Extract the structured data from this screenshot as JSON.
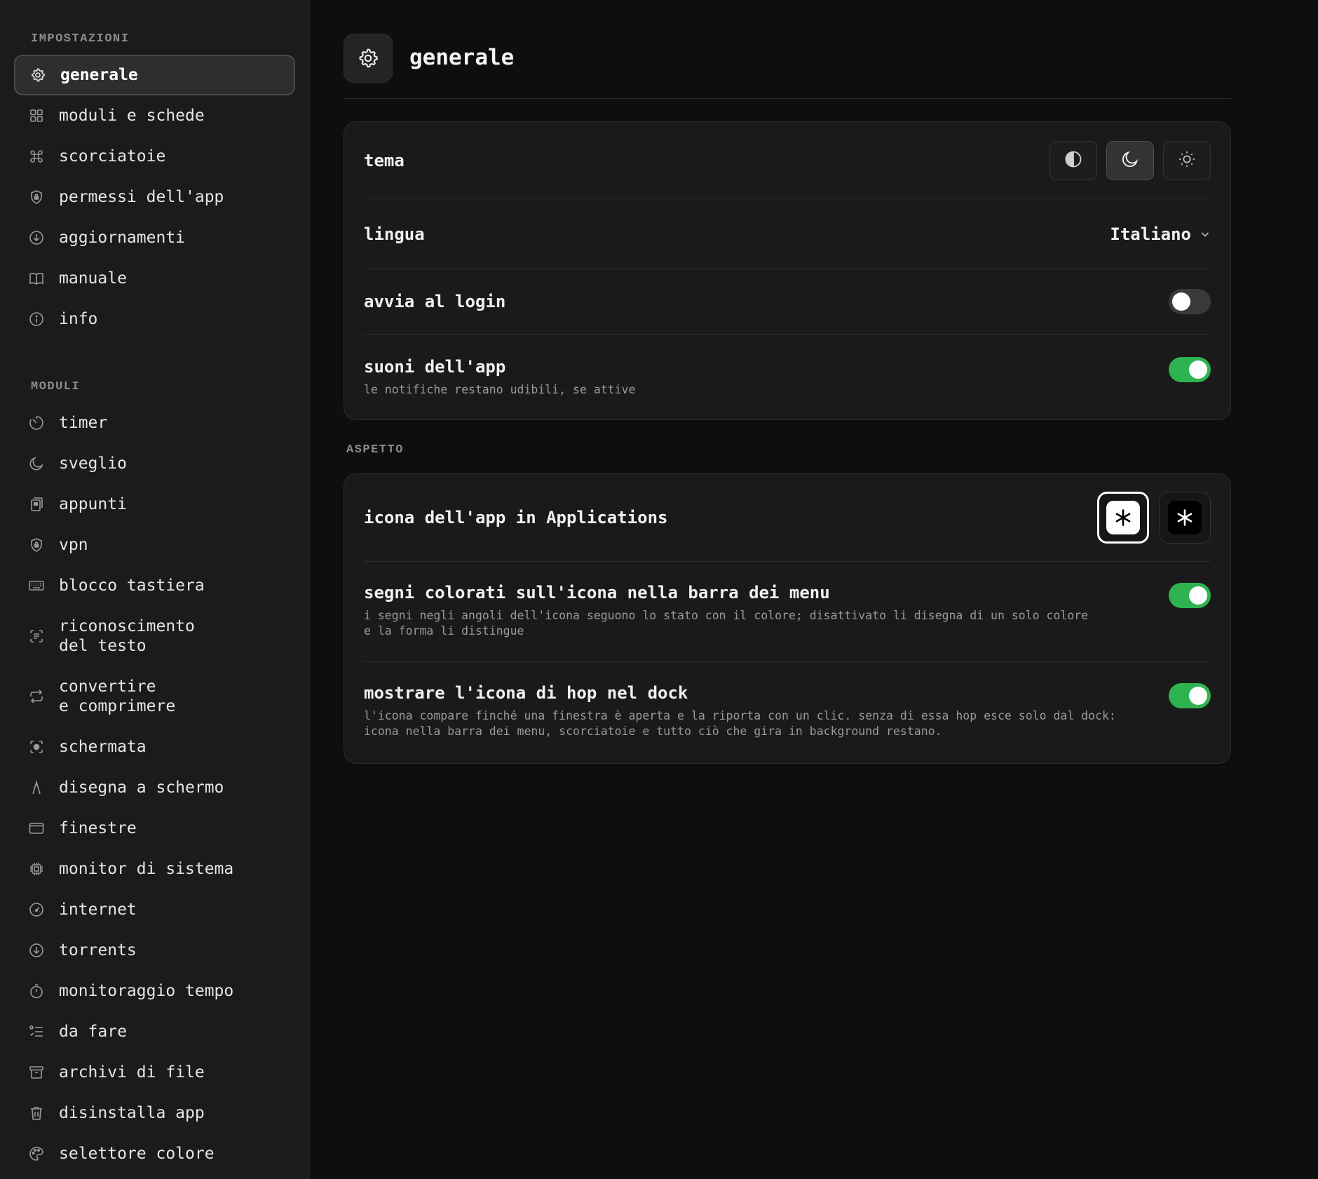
{
  "sidebar": {
    "section_settings": "IMPOSTAZIONI",
    "settings_items": [
      {
        "label": "generale",
        "icon": "gear-icon"
      },
      {
        "label": "moduli e schede",
        "icon": "grid-icon"
      },
      {
        "label": "scorciatoie",
        "icon": "command-icon"
      },
      {
        "label": "permessi dell'app",
        "icon": "shield-lock-icon"
      },
      {
        "label": "aggiornamenti",
        "icon": "download-circle-icon"
      },
      {
        "label": "manuale",
        "icon": "book-icon"
      },
      {
        "label": "info",
        "icon": "info-icon"
      }
    ],
    "section_modules": "MODULI",
    "module_items": [
      {
        "label": "timer",
        "icon": "timer-icon"
      },
      {
        "label": "sveglio",
        "icon": "moon-icon"
      },
      {
        "label": "appunti",
        "icon": "clipboard-icon"
      },
      {
        "label": "vpn",
        "icon": "shield-lock-icon"
      },
      {
        "label": "blocco tastiera",
        "icon": "keyboard-icon"
      },
      {
        "label": "riconoscimento\ndel testo",
        "icon": "text-scan-icon"
      },
      {
        "label": "convertire\ne comprimere",
        "icon": "convert-icon"
      },
      {
        "label": "schermata",
        "icon": "screenshot-icon"
      },
      {
        "label": "disegna a schermo",
        "icon": "pen-icon"
      },
      {
        "label": "finestre",
        "icon": "window-icon"
      },
      {
        "label": "monitor di sistema",
        "icon": "cpu-icon"
      },
      {
        "label": "internet",
        "icon": "speedometer-icon"
      },
      {
        "label": "torrents",
        "icon": "download-circle-icon"
      },
      {
        "label": "monitoraggio tempo",
        "icon": "stopwatch-icon"
      },
      {
        "label": "da fare",
        "icon": "checklist-icon"
      },
      {
        "label": "archivi di file",
        "icon": "archive-icon"
      },
      {
        "label": "disinstalla app",
        "icon": "trash-icon"
      },
      {
        "label": "selettore colore",
        "icon": "palette-icon"
      }
    ]
  },
  "header": {
    "title": "generale",
    "icon": "gear-icon"
  },
  "general": {
    "tema_label": "tema",
    "tema_options": [
      "contrast-icon",
      "moon-icon",
      "sun-icon"
    ],
    "tema_selected": "moon-icon",
    "lingua_label": "lingua",
    "lingua_value": "Italiano",
    "login_label": "avvia al login",
    "login_on": false,
    "suoni_label": "suoni dell'app",
    "suoni_desc": "le notifiche restano udibili, se attive",
    "suoni_on": true
  },
  "aspetto": {
    "section_label": "ASPETTO",
    "icona_label": "icona dell'app in Applications",
    "icona_options": [
      "light",
      "dark"
    ],
    "icona_selected": "light",
    "segni_label": "segni colorati sull'icona nella barra dei menu",
    "segni_desc": "i segni negli angoli dell'icona seguono lo stato con il colore; disattivato li disegna di un solo colore\ne la forma li distingue",
    "segni_on": true,
    "dock_label": "mostrare l'icona di hop nel dock",
    "dock_desc": "l'icona compare finché una finestra è aperta e la riporta con un clic. senza di essa hop esce solo dal dock:\nicona nella barra dei menu, scorciatoie e tutto ciò che gira in background restano.",
    "dock_on": true
  },
  "colors": {
    "toggle_on": "#2fb350",
    "toggle_off": "#3a3a3a",
    "sidebar_bg": "#1b1b1b",
    "main_bg": "#0e0e0e",
    "card_bg": "#1a1a1a"
  }
}
